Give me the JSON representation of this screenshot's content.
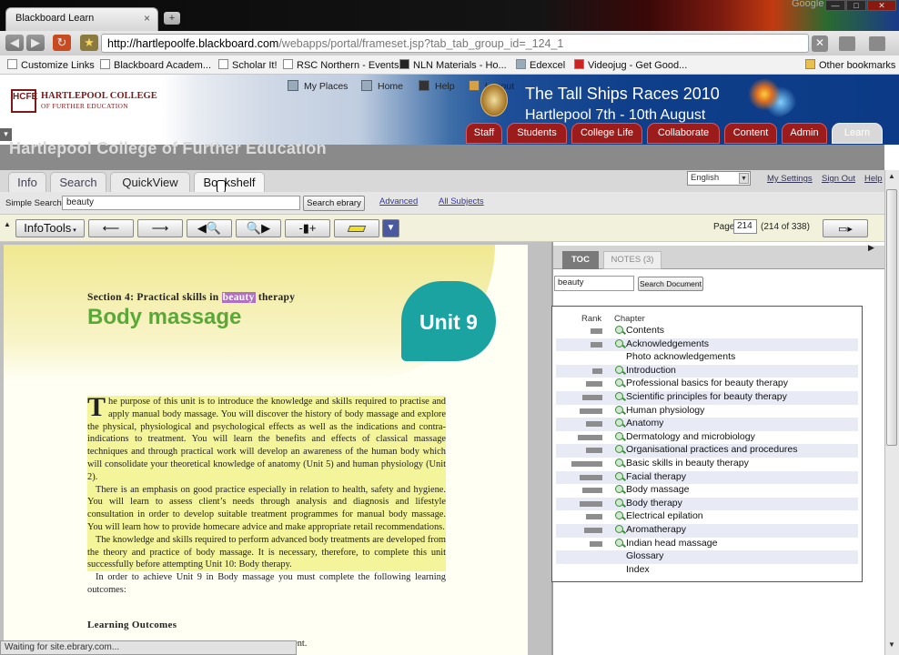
{
  "browser": {
    "tab_title": "Blackboard Learn",
    "tab_close": "×",
    "new_tab": "+",
    "brand": "Google",
    "window_controls": {
      "minimize": "—",
      "maximize": "□",
      "close": "✕"
    },
    "nav": {
      "back": "◀",
      "forward": "▶",
      "reload": "↻",
      "star": "★"
    },
    "url_host": "http://hartlepoolfe.blackboard.com",
    "url_path": "/webapps/portal/frameset.jsp?tab_tab_group_id=_124_1",
    "stop": "✕",
    "bookmarks": [
      "Customize Links",
      "Blackboard Academ...",
      "Scholar It!",
      "RSC Northern - Events",
      "NLN Materials - Ho...",
      "Edexcel",
      "Videojug - Get Good...",
      "Other bookmarks"
    ]
  },
  "portal": {
    "logo_mark": "HCFE",
    "logo_name": "HARTLEPOOL COLLEGE",
    "logo_sub": "OF FURTHER EDUCATION",
    "top_links": {
      "my_places": "My Places",
      "home": "Home",
      "help": "Help",
      "logout": "Logout"
    },
    "banner_line1": "The Tall Ships Races 2010",
    "banner_line2": "Hartlepool 7th - 10th August",
    "nav_tabs": [
      "Staff",
      "Students",
      "College Life",
      "Collaborate",
      "Content",
      "Admin",
      "Learn"
    ],
    "active_tab": "Learn"
  },
  "page": {
    "title": "Hartlepool College of Further Education",
    "toggle": "▾"
  },
  "ebrary": {
    "tabs": [
      "Info",
      "Search",
      "QuickView",
      "Bookshelf"
    ],
    "language": "English",
    "links": {
      "my_settings": "My Settings",
      "sign_out": "Sign Out",
      "help": "Help"
    },
    "simple_search_label": "Simple Search:",
    "search_value": "beauty",
    "search_button": "Search ebrary",
    "advanced": "Advanced",
    "all_subjects": "All Subjects",
    "infotools": "InfoTools",
    "page_label": "Page",
    "page_value": "214",
    "page_of": "(214 of 338)"
  },
  "document": {
    "section_prefix": "Section 4: Practical skills in",
    "section_highlight": "beauty",
    "section_suffix": "therapy",
    "title": "Body massage",
    "unit": "Unit 9",
    "drop_cap": "T",
    "p1_a": "he purpose of this unit is to introduce the knowledge and skills required to practise and apply manual body massage. You will discover the history of body massage and explore the physical, physiological and psychological effects as well as the indications and contra-indications to treatment. You will learn the benefits and effects of classical massage techniques and through practical work will develop an awareness of the human body which will consolidate your theoretical knowledge of anatomy (Unit 5) and human physiology (Unit 2).",
    "p2": "There is an emphasis on good practice especially in relation to health, safety and hygiene. You will learn to assess client’s needs through analysis and diagnosis and lifestyle consultation in order to develop suitable treatment programmes for manual body massage. You will learn how to provide homecare advice and make appropriate retail recommendations.",
    "p3": "The knowledge and skills required to perform advanced body treatments are developed from the theory and practice of body massage. It is necessary, therefore, to complete this unit successfully before attempting Unit 10: Body therapy.",
    "p4": "In order to achieve Unit 9 in Body massage you must complete the following learning outcomes:",
    "learning_heading": "Learning Outcomes",
    "tail": "ment."
  },
  "status_text": "Waiting for site.ebrary.com...",
  "toc": {
    "tab_toc": "TOC",
    "tab_notes": "NOTES (3)",
    "search_value": "beauty",
    "search_button": "Search Document",
    "head_rank": "Rank",
    "head_chapter": "Chapter",
    "rows": [
      {
        "label": "Contents",
        "rank": 0.35,
        "icon": true
      },
      {
        "label": "Acknowledgements",
        "rank": 0.35,
        "icon": true
      },
      {
        "label": "Photo acknowledgements",
        "rank": 0,
        "icon": false
      },
      {
        "label": "Introduction",
        "rank": 0.3,
        "icon": true
      },
      {
        "label": "Professional basics for beauty therapy",
        "rank": 0.5,
        "icon": true
      },
      {
        "label": "Scientific principles for beauty therapy",
        "rank": 0.6,
        "icon": true
      },
      {
        "label": "Human physiology",
        "rank": 0.7,
        "icon": true
      },
      {
        "label": "Anatomy",
        "rank": 0.5,
        "icon": true
      },
      {
        "label": "Dermatology and microbiology",
        "rank": 0.75,
        "icon": true
      },
      {
        "label": "Organisational practices and procedures",
        "rank": 0.5,
        "icon": true
      },
      {
        "label": "Basic skills in beauty therapy",
        "rank": 0.95,
        "icon": true
      },
      {
        "label": "Facial therapy",
        "rank": 0.7,
        "icon": true
      },
      {
        "label": "Body massage",
        "rank": 0.6,
        "icon": true
      },
      {
        "label": "Body therapy",
        "rank": 0.7,
        "icon": true
      },
      {
        "label": "Electrical epilation",
        "rank": 0.5,
        "icon": true
      },
      {
        "label": "Aromatherapy",
        "rank": 0.55,
        "icon": true
      },
      {
        "label": "Indian head massage",
        "rank": 0.4,
        "icon": true
      },
      {
        "label": "Glossary",
        "rank": 0,
        "icon": false
      },
      {
        "label": "Index",
        "rank": 0,
        "icon": false
      }
    ]
  },
  "colors": {
    "portal_tab": "#9c1c1c",
    "badge": "#1aa3a0",
    "title_green": "#5aa838",
    "highlight": "#f4f49a"
  }
}
